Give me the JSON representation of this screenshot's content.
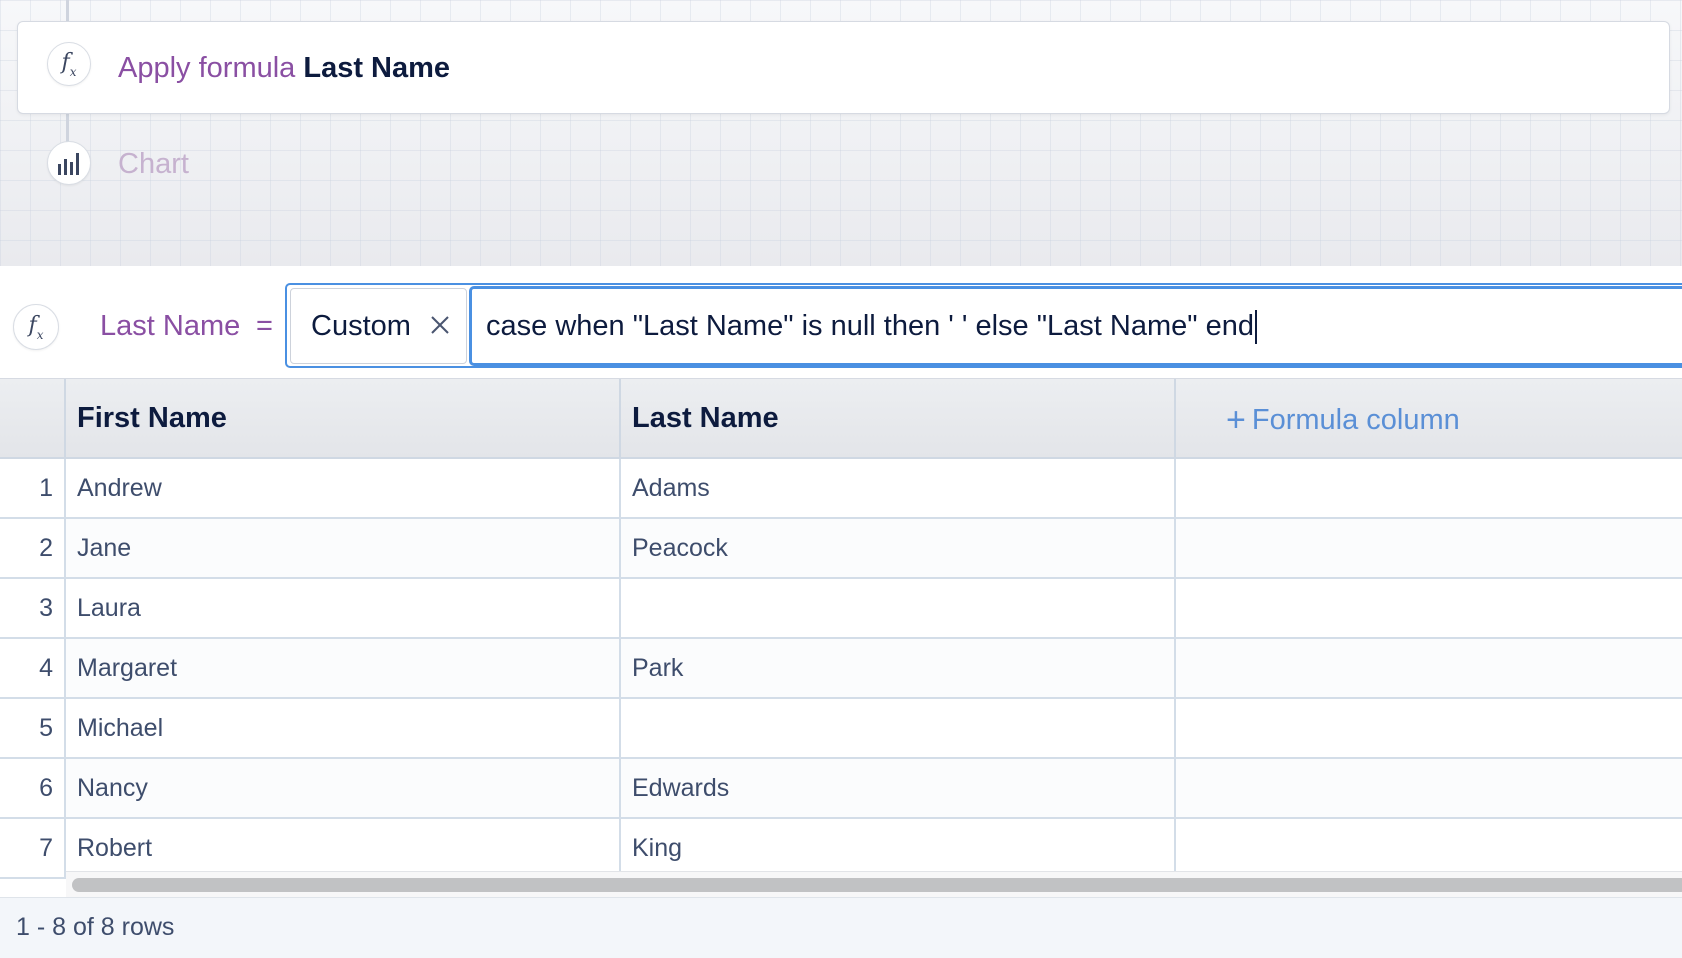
{
  "pipeline": {
    "steps": [
      {
        "icon": "formula-icon",
        "action_label": "Apply formula",
        "target_label": "Last Name"
      },
      {
        "icon": "bar-chart-icon",
        "label": "Chart"
      }
    ]
  },
  "formula_bar": {
    "column_name": "Last Name",
    "equals": "=",
    "formula_type": "Custom",
    "expression": "case when \"Last Name\" is null then ' ' else \"Last Name\" end"
  },
  "table": {
    "columns": [
      "First Name",
      "Last Name"
    ],
    "add_column_label": "Formula column",
    "rows": [
      {
        "index": "1",
        "first_name": "Andrew",
        "last_name": "Adams"
      },
      {
        "index": "2",
        "first_name": "Jane",
        "last_name": "Peacock"
      },
      {
        "index": "3",
        "first_name": "Laura",
        "last_name": ""
      },
      {
        "index": "4",
        "first_name": "Margaret",
        "last_name": "Park"
      },
      {
        "index": "5",
        "first_name": "Michael",
        "last_name": ""
      },
      {
        "index": "6",
        "first_name": "Nancy",
        "last_name": "Edwards"
      },
      {
        "index": "7",
        "first_name": "Robert",
        "last_name": "King"
      }
    ]
  },
  "footer": {
    "row_count_text": "1 - 8 of 8 rows"
  },
  "colors": {
    "accent_purple": "#8a4fa3",
    "focus_blue": "#4a90e2",
    "link_blue": "#5a8fd6",
    "text_dark": "#0d1b3e"
  }
}
